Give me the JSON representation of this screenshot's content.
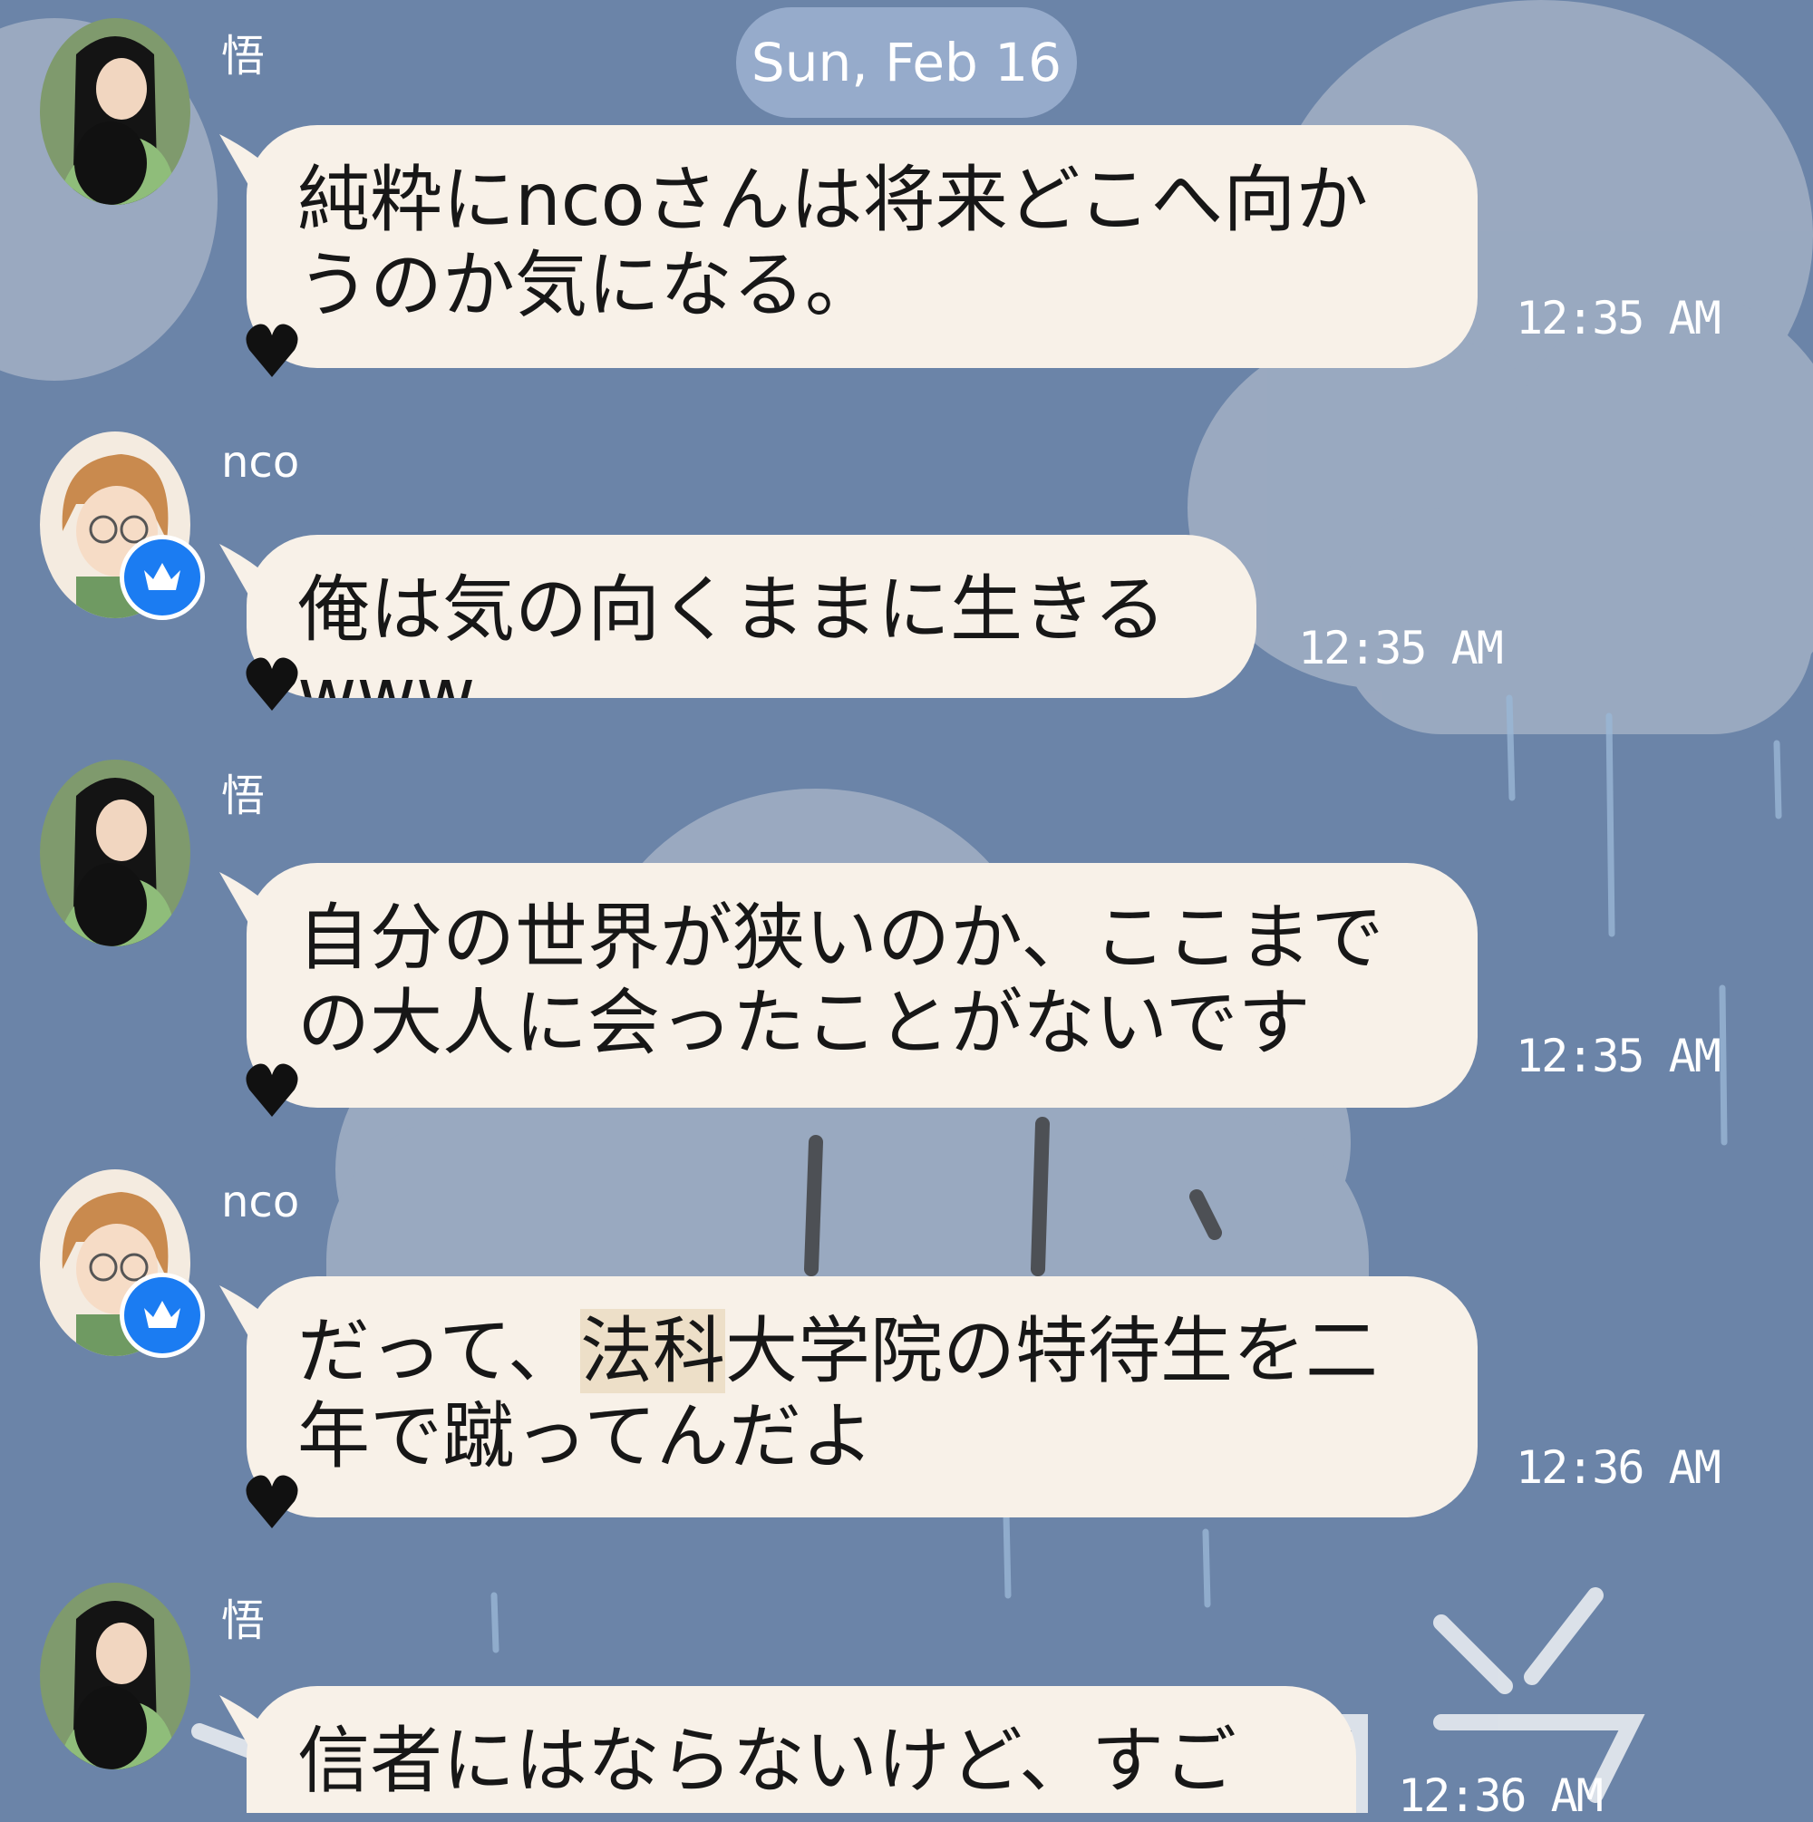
{
  "chat": {
    "date_label": "Sun, Feb 16",
    "colors": {
      "background": "#6b84a8",
      "bubble": "#f8f1e8",
      "date_pill": "#96abcb",
      "badge": "#1b7cf2",
      "heart": "#111111"
    },
    "messages": [
      {
        "sender": "悟",
        "text": "純粋にncoさんは将来どこへ向かうのか気になる。",
        "time": "12:35 AM",
        "avatar": "girl-with-black-cat-avatar",
        "verified": false
      },
      {
        "sender": "nco",
        "text": "俺は気の向くままに生きるwww",
        "time": "12:35 AM",
        "avatar": "girl-with-glasses-avatar",
        "verified": true
      },
      {
        "sender": "悟",
        "text": "自分の世界が狭いのか、ここまでの大人に会ったことがないです",
        "time": "12:35 AM",
        "avatar": "girl-with-black-cat-avatar",
        "verified": false
      },
      {
        "sender": "nco",
        "text_before": "だって、",
        "text_highlight": "法科",
        "text_after": "大学院の特待生を二年で蹴ってんだよ",
        "time": "12:36 AM",
        "avatar": "girl-with-glasses-avatar",
        "verified": true
      },
      {
        "sender": "悟",
        "text": "信者にはならないけど、すごいす",
        "time": "12:36 AM",
        "avatar": "girl-with-black-cat-avatar",
        "verified": false
      }
    ]
  }
}
